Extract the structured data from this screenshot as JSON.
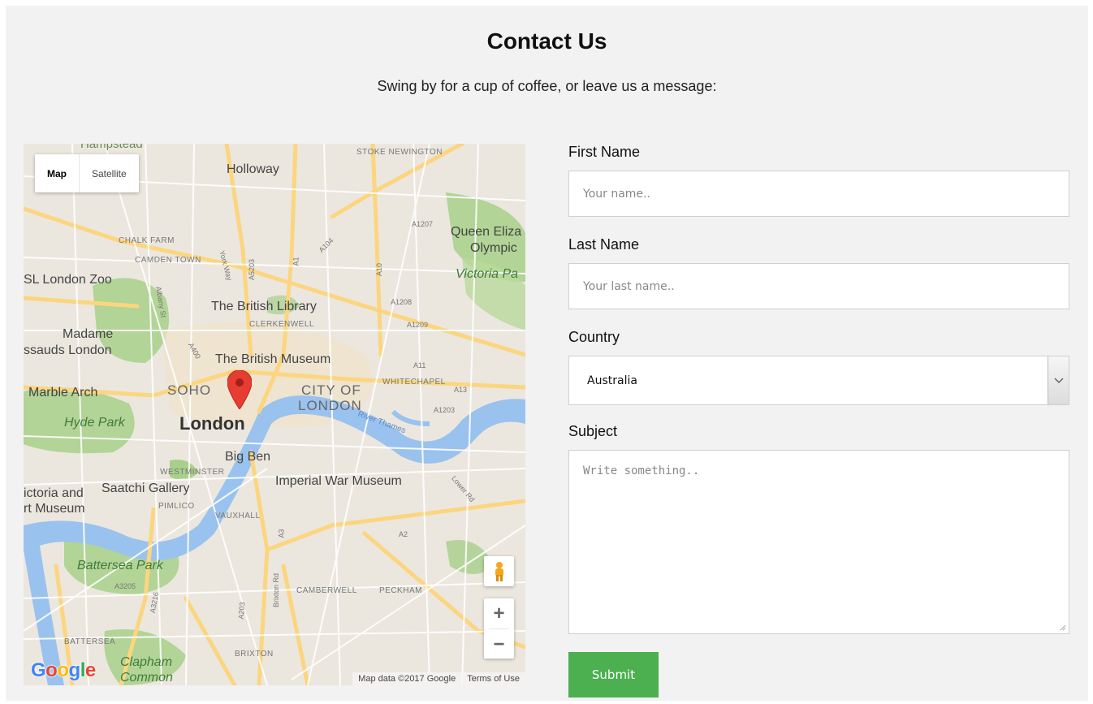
{
  "header": {
    "title": "Contact Us",
    "subtitle": "Swing by for a cup of coffee, or leave us a message:"
  },
  "map": {
    "type_controls": {
      "map_label": "Map",
      "satellite_label": "Satellite",
      "active": "Map"
    },
    "labels": {
      "hampstead": "Hampstead",
      "stoke_newington": "STOKE NEWINGTON",
      "holloway": "Holloway",
      "chalk_farm": "CHALK FARM",
      "camden_town": "CAMDEN TOWN",
      "zoo": "SL London Zoo",
      "queen_eliz": "Queen Eliza",
      "olympic": "Olympic",
      "victoria_park": "Victoria Pa",
      "british_library": "The British Library",
      "clerkenwell": "CLERKENWELL",
      "madame": "Madame",
      "tussauds": "ssauds London",
      "british_museum": "The British Museum",
      "whitechapel": "WHITECHAPEL",
      "marble_arch": "Marble Arch",
      "soho": "SOHO",
      "city_of": "CITY OF",
      "london_city": "LONDON",
      "london": "London",
      "hyde_park": "Hyde Park",
      "big_ben": "Big Ben",
      "westminster": "WESTMINSTER",
      "imperial_war_museum": "Imperial War Museum",
      "victoria_and": "ictoria and",
      "rt_museum": "rt Museum",
      "saatchi": "Saatchi Gallery",
      "pimlico": "PIMLICO",
      "vauxhall": "VAUXHALL",
      "battersea_park": "Battersea Park",
      "camberwell": "CAMBERWELL",
      "peckham": "PECKHAM",
      "battersea": "BATTERSEA",
      "brixton": "BRIXTON",
      "clapham": "Clapham",
      "common": "Common",
      "river_thames": "River Thames",
      "road_a10": "A10",
      "road_a1": "A1",
      "road_a11": "A11",
      "road_a13": "A13",
      "road_a1203": "A1203",
      "road_a3": "A3",
      "road_a2": "A2",
      "road_a205": "A205",
      "road_a3205": "A3205",
      "road_a3216": "A3216",
      "road_a203": "A203",
      "road_a23": "A23",
      "road_a1209": "A1209",
      "road_a1208": "A1208",
      "road_a1207": "A1207",
      "road_a104": "A104",
      "road_a5203": "A5203",
      "road_a501": "A501",
      "road_a400": "A400",
      "road_a4": "A4",
      "brixton_rd": "Brixton Rd",
      "albany_st": "Albany St",
      "york_way": "York Way",
      "lower_rd": "Lower Rd"
    },
    "attribution": "Map data ©2017 Google",
    "terms": "Terms of Use",
    "zoom_in": "+",
    "zoom_out": "−",
    "logo": {
      "g1": "G",
      "o1": "o",
      "o2": "o",
      "g2": "g",
      "l": "l",
      "e": "e"
    },
    "colors": {
      "land": "#ebe7df",
      "park": "#a8d08a",
      "water": "#9ac2ee",
      "major_road": "#fcd57f",
      "minor_road": "#ffffff",
      "pin": "#e63d32"
    }
  },
  "form": {
    "first_name": {
      "label": "First Name",
      "placeholder": "Your name.."
    },
    "last_name": {
      "label": "Last Name",
      "placeholder": "Your last name.."
    },
    "country": {
      "label": "Country",
      "value": "Australia"
    },
    "subject": {
      "label": "Subject",
      "placeholder": "Write something.."
    },
    "submit_label": "Submit",
    "colors": {
      "submit_bg": "#4caf50",
      "panel_bg": "#f2f2f2"
    }
  }
}
